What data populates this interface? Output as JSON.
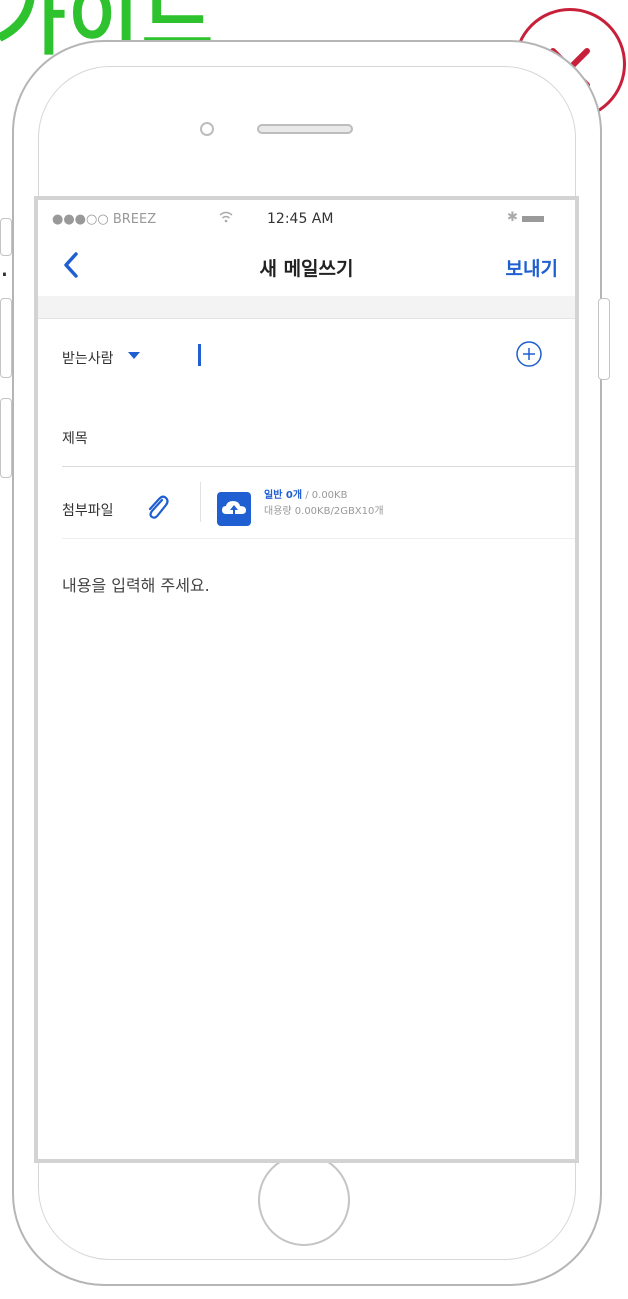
{
  "guide": {
    "title": "가이드",
    "side_text": "."
  },
  "close": {
    "label": "close"
  },
  "status_bar": {
    "carrier": "●●●○○ BREEZ",
    "time": "12:45 AM",
    "bluetooth": "✱"
  },
  "nav": {
    "title": "새 메일쓰기",
    "send": "보내기"
  },
  "fields": {
    "to_label": "받는사람",
    "subject_label": "제목",
    "attach_label": "첨부파일"
  },
  "attachment": {
    "general_label": "일반 0개",
    "general_size": " / 0.00KB",
    "large_info": "대용량 0.00KB/2GBX10개"
  },
  "body": {
    "placeholder": "내용을 입력해 주세요."
  },
  "colors": {
    "accent": "#1f5fd1",
    "guide_green": "#2ec32e",
    "close_red": "#c8203a"
  },
  "icons": [
    "close-icon",
    "back-chevron-icon",
    "caret-down-icon",
    "add-circle-icon",
    "paperclip-icon",
    "cloud-upload-icon",
    "wifi-icon",
    "battery-icon"
  ]
}
